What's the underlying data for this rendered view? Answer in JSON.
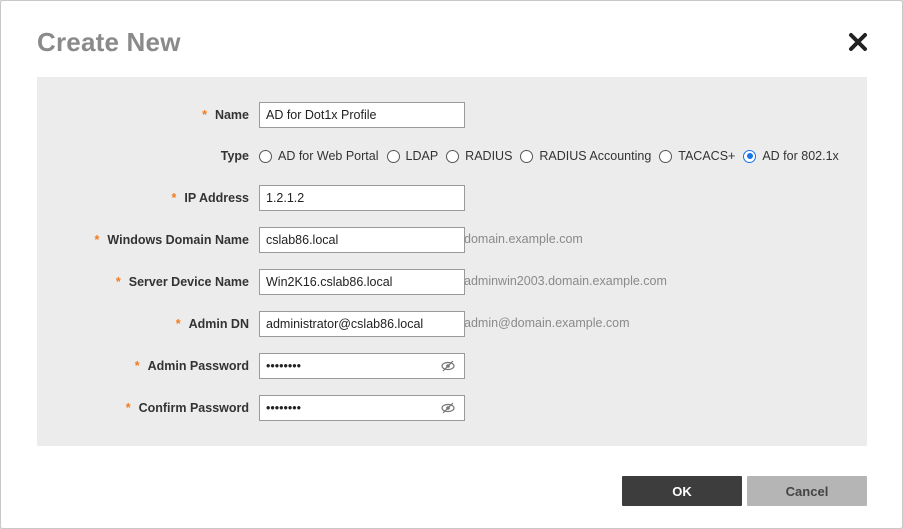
{
  "dialog": {
    "title": "Create New",
    "close_icon": "close-x-icon"
  },
  "form": {
    "required_marker": "*",
    "name": {
      "label": "Name",
      "value": "AD for Dot1x Profile"
    },
    "type": {
      "label": "Type",
      "options": [
        {
          "label": "AD for Web Portal",
          "checked": false
        },
        {
          "label": "LDAP",
          "checked": false
        },
        {
          "label": "RADIUS",
          "checked": false
        },
        {
          "label": "RADIUS Accounting",
          "checked": false
        },
        {
          "label": "TACACS+",
          "checked": false
        },
        {
          "label": "AD for 802.1x",
          "checked": true
        }
      ]
    },
    "ip_address": {
      "label": "IP Address",
      "value": "1.2.1.2"
    },
    "windows_domain": {
      "label": "Windows Domain Name",
      "value": "cslab86.local",
      "hint": "domain.example.com"
    },
    "server_device": {
      "label": "Server Device Name",
      "value": "Win2K16.cslab86.local",
      "hint": "adminwin2003.domain.example.com"
    },
    "admin_dn": {
      "label": "Admin DN",
      "value": "administrator@cslab86.local",
      "hint": "admin@domain.example.com"
    },
    "admin_password": {
      "label": "Admin Password",
      "value": "password",
      "icon": "eye-slash-icon"
    },
    "confirm_password": {
      "label": "Confirm Password",
      "value": "password",
      "icon": "eye-slash-icon"
    }
  },
  "buttons": {
    "ok": "OK",
    "cancel": "Cancel"
  },
  "colors": {
    "required": "#f47a1f",
    "ok_bg": "#3d3d3d",
    "cancel_bg": "#b5b5b5",
    "radio_checked": "#1a73e8"
  }
}
